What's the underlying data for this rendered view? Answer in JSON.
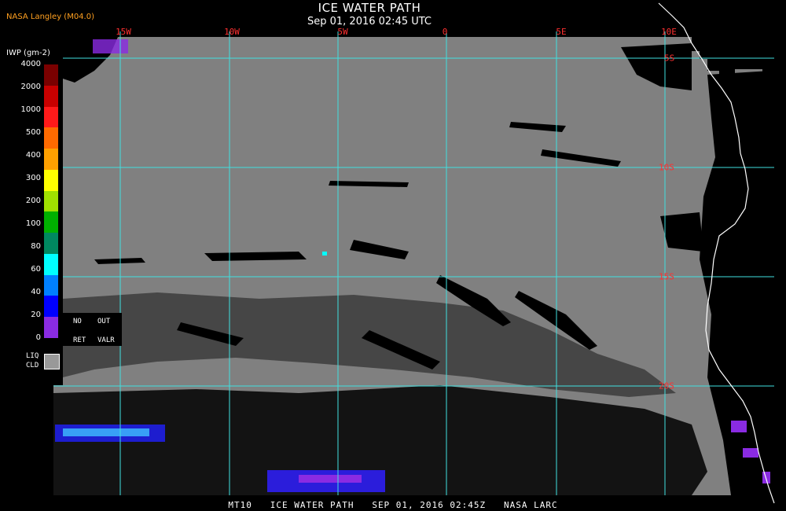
{
  "header": {
    "title": "ICE WATER PATH",
    "subtitle": "Sep 01, 2016 02:45 UTC",
    "source": "NASA Langley (M04.0)"
  },
  "longitude_labels": [
    "15W",
    "10W",
    "5W",
    "0",
    "5E",
    "10E"
  ],
  "latitude_labels": [
    "5S",
    "10S",
    "15S",
    "20S"
  ],
  "colorbar": {
    "title": "IWP (gm-2)",
    "ticks": [
      "4000",
      "2000",
      "1000",
      "500",
      "400",
      "300",
      "200",
      "100",
      "80",
      "60",
      "40",
      "20",
      "0"
    ],
    "colors": [
      "#7a0000",
      "#c80000",
      "#ff1a1a",
      "#ff6a00",
      "#ffa000",
      "#ffff00",
      "#a0e000",
      "#00b000",
      "#008860",
      "#00ffff",
      "#0080ff",
      "#0000ff",
      "#8a2be2"
    ],
    "no_ret_labels": [
      "NO",
      "OUT",
      "RET",
      "VALR"
    ],
    "liq_cld_labels": [
      "LIQ",
      "CLD"
    ],
    "liq_cld_color": "#999999"
  },
  "colors": {
    "background": "#000000",
    "surface": "#808080",
    "grid": "#40e0e0",
    "coast": "#ffffff",
    "labels": "#ff3030"
  },
  "footer": {
    "text": "MT10   ICE WATER PATH   SEP 01, 2016 02:45Z   NASA LARC"
  }
}
